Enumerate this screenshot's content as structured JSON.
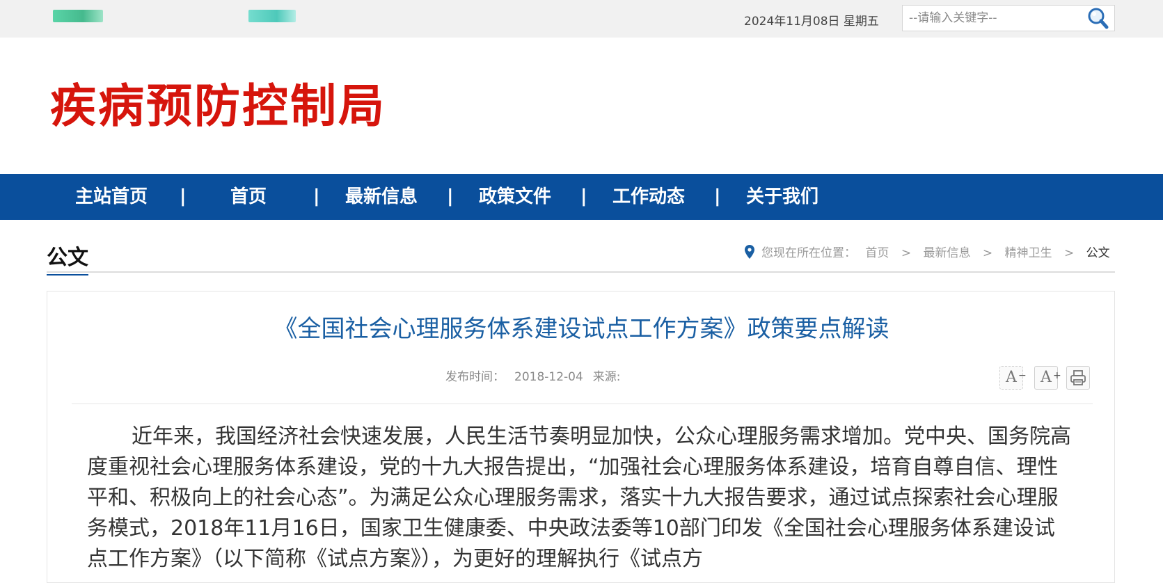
{
  "topbar": {
    "date": "2024年11月08日 星期五",
    "search_placeholder": "--请输入关键字--",
    "search_icon": "magnifier-icon"
  },
  "header": {
    "site_title": "疾病预防控制局",
    "title_color": "#d6150c"
  },
  "nav": {
    "background": "#0a4f9c",
    "items": [
      {
        "label": "主站首页"
      },
      {
        "label": "首页"
      },
      {
        "label": "最新信息"
      },
      {
        "label": "政策文件"
      },
      {
        "label": "工作动态"
      },
      {
        "label": "关于我们"
      }
    ],
    "separator": "|"
  },
  "page": {
    "section_label": "公文",
    "breadcrumb": {
      "prefix": "您现在所在位置：",
      "items": [
        "首页",
        "最新信息",
        "精神卫生",
        "公文"
      ],
      "separator": ">",
      "icon": "location-pin-icon"
    }
  },
  "article": {
    "title": "《全国社会心理服务体系建设试点工作方案》政策要点解读",
    "publish_label": "发布时间：",
    "publish_date": "2018-12-04",
    "source_label": "来源:",
    "tools": {
      "font_smaller": "A",
      "font_smaller_mark": "−",
      "font_larger": "A",
      "font_larger_mark": "+",
      "print_icon": "printer-icon"
    },
    "body": "近年来，我国经济社会快速发展，人民生活节奏明显加快，公众心理服务需求增加。党中央、国务院高度重视社会心理服务体系建设，党的十九大报告提出，“加强社会心理服务体系建设，培育自尊自信、理性平和、积极向上的社会心态”。为满足公众心理服务需求，落实十九大报告要求，通过试点探索社会心理服务模式，2018年11月16日，国家卫生健康委、中央政法委等10部门印发《全国社会心理服务体系建设试点工作方案》（以下简称《试点方案》），为更好的理解执行《试点方"
  }
}
